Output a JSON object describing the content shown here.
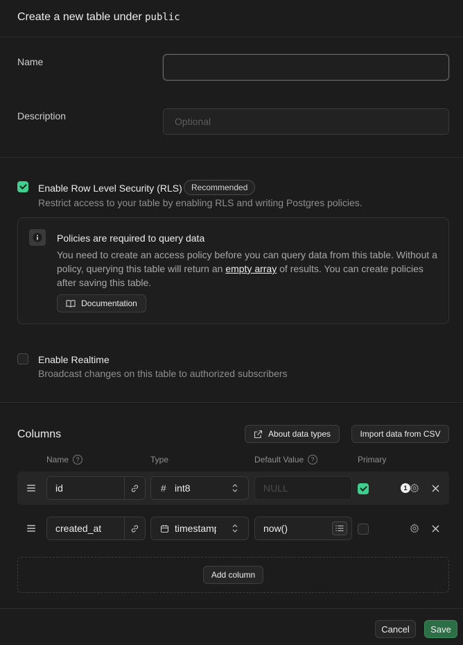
{
  "header": {
    "title_prefix": "Create a new table under",
    "schema": "public"
  },
  "form": {
    "name_label": "Name",
    "name_value": "",
    "description_label": "Description",
    "description_placeholder": "Optional"
  },
  "rls": {
    "title": "Enable Row Level Security (RLS)",
    "badge": "Recommended",
    "description": "Restrict access to your table by enabling RLS and writing Postgres policies.",
    "enabled": true,
    "callout": {
      "title": "Policies are required to query data",
      "body_before": "You need to create an access policy before you can query data from this table. Without a policy, querying this table will return an",
      "body_link": "empty array",
      "body_after": "of results. You can create policies after saving this table.",
      "doc_button": "Documentation"
    }
  },
  "realtime": {
    "title": "Enable Realtime",
    "description": "Broadcast changes on this table to authorized subscribers",
    "enabled": false
  },
  "columns": {
    "title": "Columns",
    "about_button": "About data types",
    "import_button": "Import data from CSV",
    "headers": {
      "name": "Name",
      "type": "Type",
      "default": "Default Value",
      "primary": "Primary"
    },
    "rows": [
      {
        "name": "id",
        "type_icon": "hash-icon",
        "type": "int8",
        "default": "NULL",
        "default_disabled": true,
        "primary": true,
        "settings_badge": "1"
      },
      {
        "name": "created_at",
        "type_icon": "calendar-icon",
        "type": "timestamp",
        "default": "now()",
        "default_disabled": false,
        "primary": false
      }
    ],
    "add_button": "Add column"
  },
  "footer": {
    "cancel": "Cancel",
    "save": "Save"
  },
  "colors": {
    "accent": "#3ecf8e",
    "save_bg": "#2c6e46",
    "background": "#1c1c1c"
  }
}
